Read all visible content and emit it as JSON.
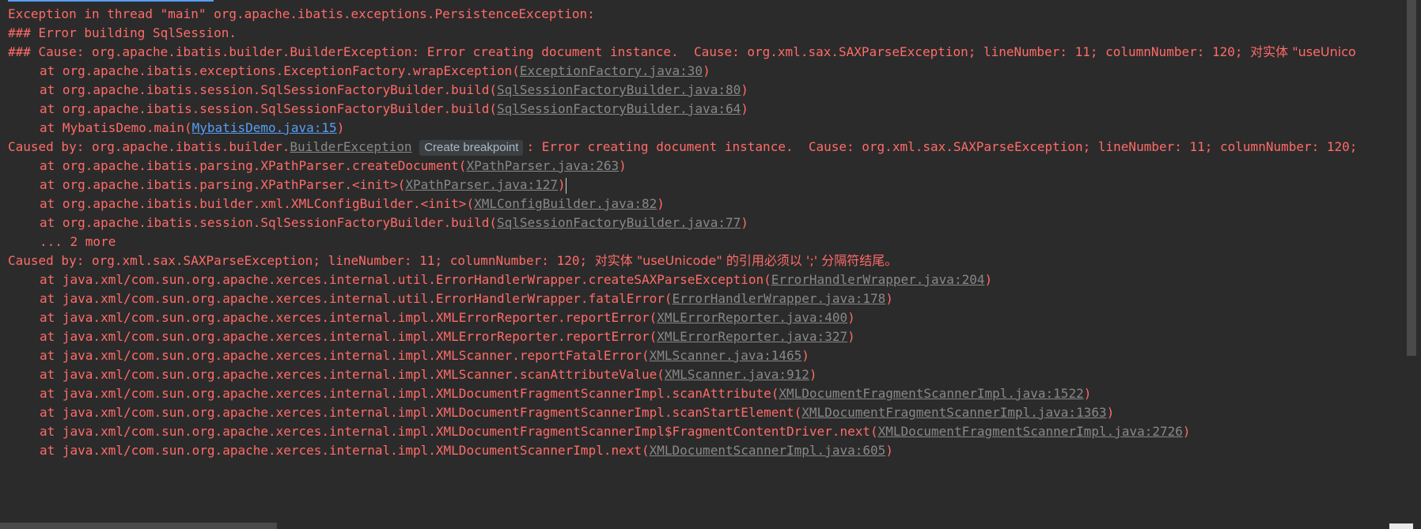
{
  "console": {
    "lines": [
      {
        "text": "Exception in thread \"main\" org.apache.ibatis.exceptions.PersistenceException:"
      },
      {
        "text": "### Error building SqlSession."
      },
      {
        "text": "### Cause: org.apache.ibatis.builder.BuilderException: Error creating document instance.  Cause: org.xml.sax.SAXParseException; lineNumber: 11; columnNumber: 120; ",
        "cjk": "对实体 \"useUnico"
      },
      {
        "pre": "at org.apache.ibatis.exceptions.ExceptionFactory.wrapException(",
        "link": "ExceptionFactory.java:30",
        "post": ")"
      },
      {
        "pre": "at org.apache.ibatis.session.SqlSessionFactoryBuilder.build(",
        "link": "SqlSessionFactoryBuilder.java:80",
        "post": ")"
      },
      {
        "pre": "at org.apache.ibatis.session.SqlSessionFactoryBuilder.build(",
        "link": "SqlSessionFactoryBuilder.java:64",
        "post": ")"
      },
      {
        "pre": "at MybatisDemo.main(",
        "link": "MybatisDemo.java:15",
        "post": ")"
      },
      {
        "pre": "Caused by: org.apache.ibatis.builder.",
        "link": "BuilderException",
        "tooltip": "Create breakpoint",
        "post": ": Error creating document instance.  Cause: org.xml.sax.SAXParseException; lineNumber: 11; columnNumber: 120;"
      },
      {
        "pre": "at org.apache.ibatis.parsing.XPathParser.createDocument(",
        "link": "XPathParser.java:263",
        "post": ")"
      },
      {
        "pre": "at org.apache.ibatis.parsing.XPathParser.<init>(",
        "link": "XPathParser.java:127",
        "post": ")"
      },
      {
        "pre": "at org.apache.ibatis.builder.xml.XMLConfigBuilder.<init>(",
        "link": "XMLConfigBuilder.java:82",
        "post": ")"
      },
      {
        "pre": "at org.apache.ibatis.session.SqlSessionFactoryBuilder.build(",
        "link": "SqlSessionFactoryBuilder.java:77",
        "post": ")"
      },
      {
        "text": "... 2 more"
      },
      {
        "text": "Caused by: org.xml.sax.SAXParseException; lineNumber: 11; columnNumber: 120; ",
        "cjk": "对实体 \"useUnicode\" 的引用必须以 ';' 分隔符结尾。"
      },
      {
        "pre": "at java.xml/com.sun.org.apache.xerces.internal.util.ErrorHandlerWrapper.createSAXParseException(",
        "link": "ErrorHandlerWrapper.java:204",
        "post": ")"
      },
      {
        "pre": "at java.xml/com.sun.org.apache.xerces.internal.util.ErrorHandlerWrapper.fatalError(",
        "link": "ErrorHandlerWrapper.java:178",
        "post": ")"
      },
      {
        "pre": "at java.xml/com.sun.org.apache.xerces.internal.impl.XMLErrorReporter.reportError(",
        "link": "XMLErrorReporter.java:400",
        "post": ")"
      },
      {
        "pre": "at java.xml/com.sun.org.apache.xerces.internal.impl.XMLErrorReporter.reportError(",
        "link": "XMLErrorReporter.java:327",
        "post": ")"
      },
      {
        "pre": "at java.xml/com.sun.org.apache.xerces.internal.impl.XMLScanner.reportFatalError(",
        "link": "XMLScanner.java:1465",
        "post": ")"
      },
      {
        "pre": "at java.xml/com.sun.org.apache.xerces.internal.impl.XMLScanner.scanAttributeValue(",
        "link": "XMLScanner.java:912",
        "post": ")"
      },
      {
        "pre": "at java.xml/com.sun.org.apache.xerces.internal.impl.XMLDocumentFragmentScannerImpl.scanAttribute(",
        "link": "XMLDocumentFragmentScannerImpl.java:1522",
        "post": ")"
      },
      {
        "pre": "at java.xml/com.sun.org.apache.xerces.internal.impl.XMLDocumentFragmentScannerImpl.scanStartElement(",
        "link": "XMLDocumentFragmentScannerImpl.java:1363",
        "post": ")"
      },
      {
        "pre": "at java.xml/com.sun.org.apache.xerces.internal.impl.XMLDocumentFragmentScannerImpl$FragmentContentDriver.next(",
        "link": "XMLDocumentFragmentScannerImpl.java:2726",
        "post": ")"
      },
      {
        "pre": "at java.xml/com.sun.org.apache.xerces.internal.impl.XMLDocumentScannerImpl.next(",
        "link": "XMLDocumentScannerImpl.java:605",
        "post": ")"
      }
    ]
  },
  "colors": {
    "background": "#2b2b2b",
    "error_text": "#ff6b68",
    "stack_link": "#888888",
    "user_code_link": "#589df6"
  }
}
